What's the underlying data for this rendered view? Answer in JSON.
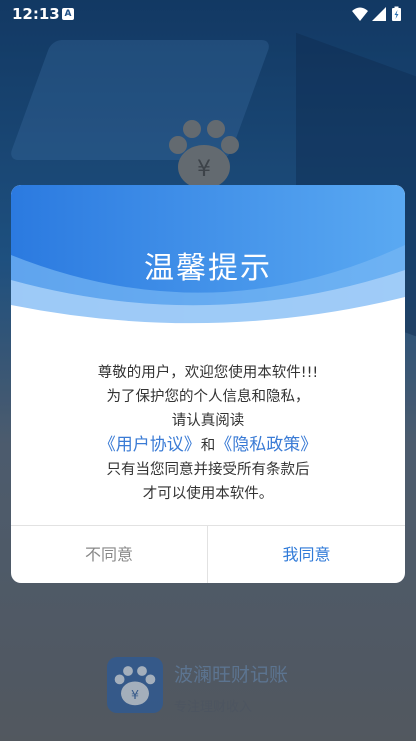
{
  "status_bar": {
    "time": "12:13",
    "notification_badge": "A",
    "icons": [
      "wifi-icon",
      "signal-icon",
      "battery-charging-icon"
    ]
  },
  "dialog": {
    "title": "温馨提示",
    "lines": [
      "尊敬的用户，欢迎您使用本软件!!!",
      "为了保护您的个人信息和隐私，",
      "请认真阅读"
    ],
    "user_agreement_link": "《用户协议》",
    "and_text": "和",
    "privacy_policy_link": "《隐私政策》",
    "line_after_1": "只有当您同意并接受所有条款后",
    "line_after_2": "才可以使用本软件。",
    "disagree_label": "不同意",
    "agree_label": "我同意"
  },
  "brand": {
    "name": "波澜旺财记账",
    "slogan": "专注理财收入"
  },
  "colors": {
    "header_blue": "#3d8de8",
    "link_blue": "#3a7bd5",
    "agree_blue": "#2f7ad8",
    "disagree_gray": "#888888"
  }
}
